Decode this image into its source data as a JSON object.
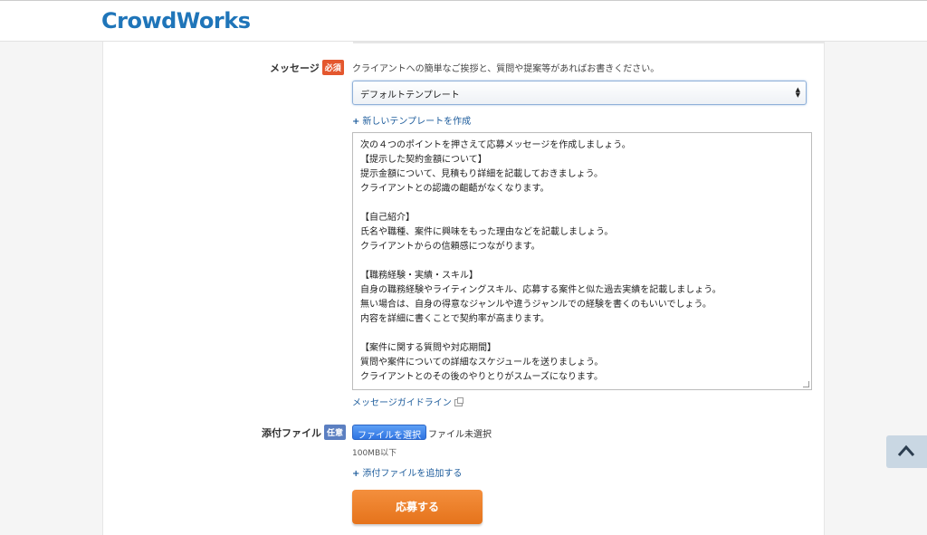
{
  "header": {
    "logo": "CrowdWorks"
  },
  "message": {
    "label": "メッセージ",
    "required_badge": "必須",
    "hint": "クライアントへの簡単なご挨拶と、質問や提案等があればお書きください。",
    "template_select_value": "デフォルトテンプレート",
    "new_template_link": "新しいテンプレートを作成",
    "body_lines": [
      "次の４つのポイントを押さえて応募メッセージを作成しましょう。",
      "【提示した契約金額について】",
      "提示金額について、見積もり詳細を記載しておきましょう。",
      "クライアントとの認識の齟齬がなくなります。",
      "",
      "【自己紹介】",
      "氏名や職種、案件に興味をもった理由などを記載しましょう。",
      "クライアントからの信頼感につながります。",
      "",
      "【職務経験・実績・スキル】",
      "自身の職務経験やライティングスキル、応募する案件と似た過去実績を記載しましょう。",
      "無い場合は、自身の得意なジャンルや違うジャンルでの経験を書くのもいいでしょう。",
      "内容を詳細に書くことで契約率が高まります。",
      "",
      "【案件に関する質問や対応期間】",
      "質問や案件についての詳細なスケジュールを送りましょう。",
      "クライアントとのその後のやりとりがスムーズになります。"
    ],
    "guideline_link": "メッセージガイドライン"
  },
  "attachment": {
    "label": "添付ファイル",
    "optional_badge": "任意",
    "choose_button": "ファイルを選択",
    "status": "ファイル未選択",
    "size_limit": "100MB以下",
    "add_link": "添付ファイルを追加する"
  },
  "submit_label": "応募する",
  "icons": {
    "back_to_top": "chevron-up-icon",
    "external": "external-link-icon",
    "plus": "plus-icon"
  }
}
